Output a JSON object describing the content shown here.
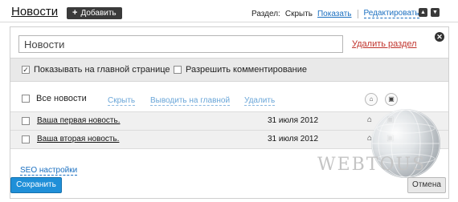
{
  "header": {
    "title": "Новости",
    "add_label": "Добавить",
    "section_label": "Раздел:",
    "section_state": "Скрыть",
    "show_link": "Показать",
    "edit_link": "Редактировать"
  },
  "panel": {
    "name_value": "Новости",
    "delete_section": "Удалить раздел",
    "options": [
      {
        "label": "Показывать на главной странице",
        "checked": true
      },
      {
        "label": "Разрешить комментирование",
        "checked": false
      }
    ],
    "list": {
      "all_label": "Все новости",
      "actions": [
        "Скрыть",
        "Выводить на главной",
        "Удалить"
      ]
    },
    "news": [
      {
        "title": "Ваша первая новость.",
        "date": "31 июля 2012"
      },
      {
        "title": "Ваша вторая новость.",
        "date": "31 июля 2012"
      }
    ],
    "seo_link": "SEO настройки",
    "save_label": "Сохранить",
    "cancel_label": "Отмена"
  },
  "watermark": {
    "text": "WEBTOUS"
  },
  "icons": {
    "add": "plus-icon",
    "up": "arrow-up-icon",
    "down": "arrow-down-icon",
    "close": "close-icon",
    "home": "home-icon",
    "comments": "comments-icon"
  },
  "colors": {
    "link": "#1a6fc0",
    "danger_link": "#c0332c",
    "primary_button": "#1f8fd8",
    "options_bar": "#e9e9e9"
  }
}
